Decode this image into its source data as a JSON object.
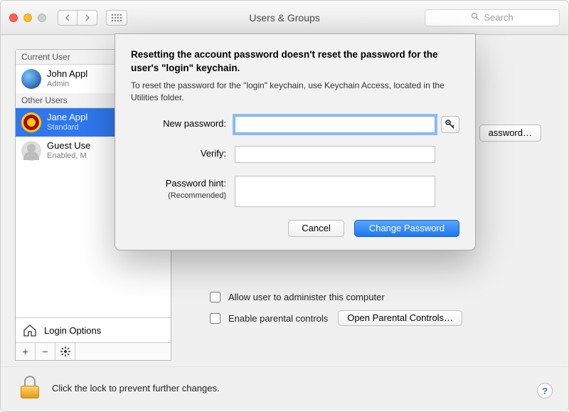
{
  "window": {
    "title": "Users & Groups",
    "search_placeholder": "Search"
  },
  "sidebar": {
    "current_label": "Current User",
    "other_label": "Other Users",
    "current_user": {
      "name": "John Appl",
      "role": "Admin"
    },
    "others": [
      {
        "name": "Jane Appl",
        "role": "Standard",
        "selected": true
      },
      {
        "name": "Guest Use",
        "role": "Enabled, M",
        "selected": false
      }
    ],
    "login_options": "Login Options"
  },
  "main": {
    "change_password_btn": "assword…",
    "allow_admin": "Allow user to administer this computer",
    "enable_parental": "Enable parental controls",
    "open_parental": "Open Parental Controls…"
  },
  "sheet": {
    "heading": "Resetting the account password doesn't reset the password for the user's \"login\" keychain.",
    "subtext": "To reset the password for the \"login\" keychain, use Keychain Access, located in the Utilities folder.",
    "new_password_label": "New password:",
    "verify_label": "Verify:",
    "hint_label": "Password hint:",
    "hint_sub": "(Recommended)",
    "cancel": "Cancel",
    "confirm": "Change Password"
  },
  "footer": {
    "lock_text": "Click the lock to prevent further changes."
  }
}
